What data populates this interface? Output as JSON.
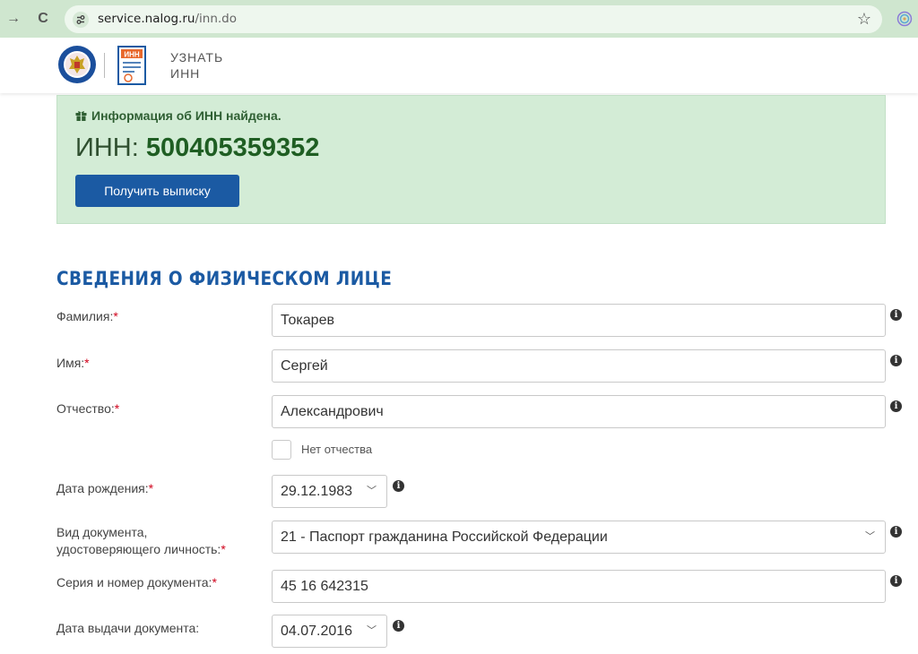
{
  "browser": {
    "url_host": "service.nalog.ru",
    "url_path": "/inn.do"
  },
  "header": {
    "title_line1": "УЗНАТЬ",
    "title_line2": "ИНН",
    "doc_icon_label": "ИНН"
  },
  "result": {
    "message": "Информация об ИНН найдена.",
    "inn_label": "ИНН:",
    "inn_value": "500405359352",
    "button_label": "Получить выписку"
  },
  "section": {
    "title": "СВЕДЕНИЯ О ФИЗИЧЕСКОМ ЛИЦЕ"
  },
  "fields": {
    "surname": {
      "label": "Фамилия:",
      "value": "Токарев"
    },
    "name": {
      "label": "Имя:",
      "value": "Сергей"
    },
    "patronymic": {
      "label": "Отчество:",
      "value": "Александрович"
    },
    "no_patronymic": {
      "label": "Нет отчества",
      "checked": false
    },
    "birth_date": {
      "label": "Дата рождения:",
      "value": "29.12.1983"
    },
    "doc_type": {
      "label_line1": "Вид документа,",
      "label_line2": "удостоверяющего личность:",
      "value": "21 - Паспорт гражданина Российской Федерации"
    },
    "doc_number": {
      "label": "Серия и номер документа:",
      "value": "45 16 642315"
    },
    "issue_date": {
      "label": "Дата выдачи документа:",
      "value": "04.07.2016"
    }
  },
  "required_mark": "*",
  "colors": {
    "accent": "#1b5aa3",
    "success_bg": "#d3ecd6",
    "required": "#d0021b"
  }
}
